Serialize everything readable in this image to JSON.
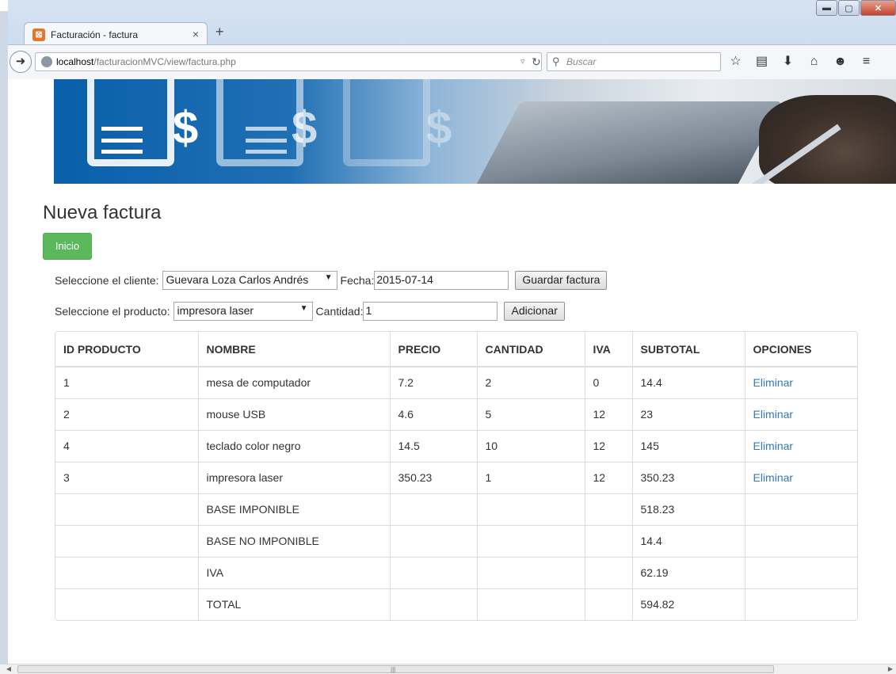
{
  "browser": {
    "tab_title": "Facturación - factura",
    "tab_close": "×",
    "new_tab": "+",
    "url_host": "localhost",
    "url_path": "/facturacionMVC/view/factura.php",
    "search_placeholder": "Buscar"
  },
  "page": {
    "title": "Nueva factura",
    "inicio_label": "Inicio"
  },
  "form": {
    "cliente_label": "Seleccione el cliente:",
    "cliente_value": "Guevara Loza Carlos Andrés",
    "fecha_label": "Fecha:",
    "fecha_value": "2015-07-14",
    "guardar_label": "Guardar factura",
    "producto_label": "Seleccione el producto:",
    "producto_value": "impresora laser",
    "cantidad_label": "Cantidad:",
    "cantidad_value": "1",
    "adicionar_label": "Adicionar"
  },
  "table": {
    "headers": [
      "ID PRODUCTO",
      "NOMBRE",
      "PRECIO",
      "CANTIDAD",
      "IVA",
      "SUBTOTAL",
      "OPCIONES"
    ],
    "rows": [
      {
        "id": "1",
        "nombre": "mesa de computador",
        "precio": "7.2",
        "cantidad": "2",
        "iva": "0",
        "subtotal": "14.4",
        "opcion": "Eliminar"
      },
      {
        "id": "2",
        "nombre": "mouse USB",
        "precio": "4.6",
        "cantidad": "5",
        "iva": "12",
        "subtotal": "23",
        "opcion": "Eliminar"
      },
      {
        "id": "4",
        "nombre": "teclado color negro",
        "precio": "14.5",
        "cantidad": "10",
        "iva": "12",
        "subtotal": "145",
        "opcion": "Eliminar"
      },
      {
        "id": "3",
        "nombre": "impresora laser",
        "precio": "350.23",
        "cantidad": "1",
        "iva": "12",
        "subtotal": "350.23",
        "opcion": "Eliminar"
      }
    ],
    "totals": [
      {
        "label": "BASE IMPONIBLE",
        "value": "518.23"
      },
      {
        "label": "BASE NO IMPONIBLE",
        "value": "14.4"
      },
      {
        "label": "IVA",
        "value": "62.19"
      },
      {
        "label": "TOTAL",
        "value": "594.82"
      }
    ]
  },
  "icons": {
    "app": "xampp-icon",
    "back": "back-arrow-icon",
    "site": "globe-icon",
    "reload": "reload-icon",
    "search": "search-icon",
    "bookmark": "star-icon",
    "reading": "reading-list-icon",
    "download": "download-icon",
    "home": "home-icon",
    "chat": "chat-icon",
    "menu": "hamburger-menu-icon"
  },
  "colors": {
    "success": "#5cb85c",
    "link": "#337ab7",
    "banner_blue": "#0a5faa"
  }
}
